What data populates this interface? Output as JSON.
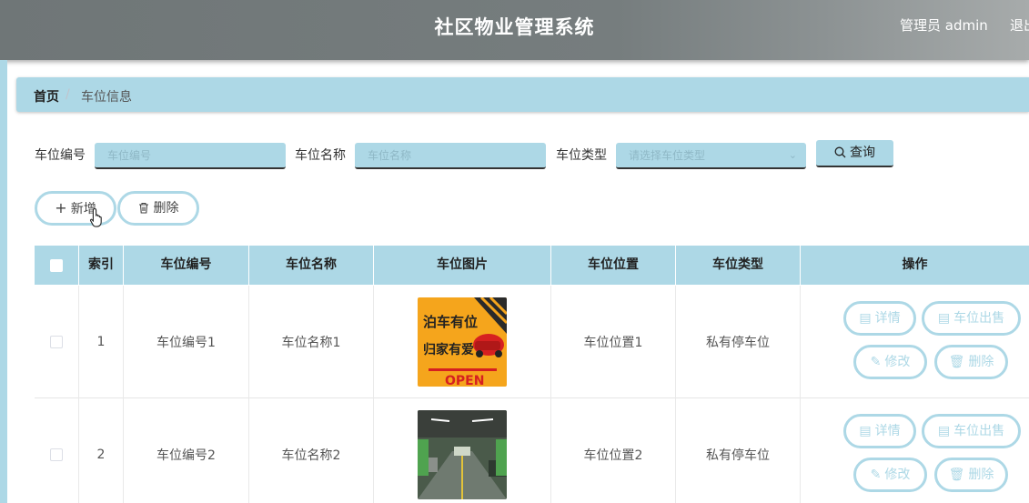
{
  "app": {
    "title": "社区物业管理系统",
    "user": "管理员 admin",
    "logout": "退出"
  },
  "breadcrumb": {
    "home": "首页",
    "separator": "/",
    "current": "车位信息"
  },
  "filters": {
    "code": {
      "label": "车位编号",
      "placeholder": "车位编号"
    },
    "name": {
      "label": "车位名称",
      "placeholder": "车位名称"
    },
    "type": {
      "label": "车位类型",
      "placeholder": "请选择车位类型"
    },
    "query": "查询"
  },
  "actions": {
    "add": "新增",
    "delete": "删除"
  },
  "table": {
    "headers": [
      "索引",
      "车位编号",
      "车位名称",
      "车位图片",
      "车位位置",
      "车位类型",
      "操作"
    ],
    "rows": [
      {
        "index": "1",
        "code": "车位编号1",
        "name": "车位名称1",
        "location": "车位位置1",
        "type": "私有停车位",
        "image_text": [
          "泊车有位",
          "归家有爱",
          "OPEN"
        ]
      },
      {
        "index": "2",
        "code": "车位编号2",
        "name": "车位名称2",
        "location": "车位位置2",
        "type": "私有停车位"
      }
    ],
    "row_ops": {
      "detail": "详情",
      "sell": "车位出售",
      "edit": "修改",
      "delete": "删除"
    }
  },
  "colors": {
    "accent": "#add8e6",
    "header_bar": "#767d7e"
  }
}
